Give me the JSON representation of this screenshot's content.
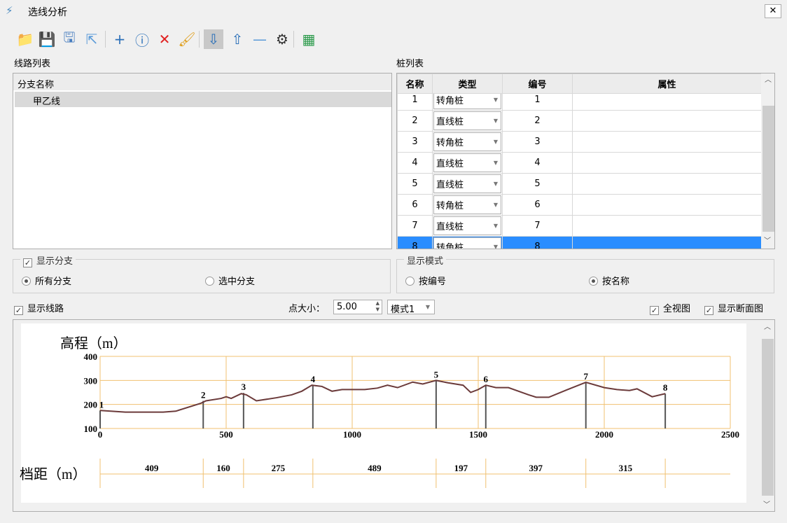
{
  "window": {
    "title": "选线分析",
    "close": "✕"
  },
  "toolbar": [
    {
      "name": "open-folder-icon",
      "glyph": "📁"
    },
    {
      "name": "save-icon",
      "glyph": "💾"
    },
    {
      "name": "save-as-icon",
      "glyph": "🖫"
    },
    {
      "name": "export-icon",
      "glyph": "⇱"
    },
    {
      "name": "add-icon",
      "glyph": "+"
    },
    {
      "name": "info-icon",
      "glyph": "ⓘ"
    },
    {
      "name": "delete-line-icon",
      "glyph": "✕"
    },
    {
      "name": "brush-icon",
      "glyph": "🖌"
    },
    {
      "name": "insert-below-icon",
      "glyph": "⇩"
    },
    {
      "name": "insert-above-icon",
      "glyph": "⇧"
    },
    {
      "name": "remove-icon",
      "glyph": "—"
    },
    {
      "name": "settings-line-icon",
      "glyph": "⚙"
    },
    {
      "name": "map-icon",
      "glyph": "▦"
    }
  ],
  "line_list": {
    "title": "线路列表",
    "header": "分支名称",
    "items": [
      "甲乙线"
    ]
  },
  "pile_list": {
    "title": "桩列表",
    "columns": [
      "名称",
      "类型",
      "编号",
      "属性"
    ],
    "rows": [
      [
        "1",
        "转角桩",
        "1",
        ""
      ],
      [
        "2",
        "直线桩",
        "2",
        ""
      ],
      [
        "3",
        "转角桩",
        "3",
        ""
      ],
      [
        "4",
        "直线桩",
        "4",
        ""
      ],
      [
        "5",
        "直线桩",
        "5",
        ""
      ],
      [
        "6",
        "转角桩",
        "6",
        ""
      ],
      [
        "7",
        "直线桩",
        "7",
        ""
      ],
      [
        "8",
        "转角桩",
        "8",
        ""
      ]
    ],
    "selected": 7
  },
  "branch_group": {
    "title": "显示分支",
    "checked": true,
    "options": [
      "所有分支",
      "选中分支"
    ],
    "selected": 0
  },
  "mode_group": {
    "title": "显示模式",
    "options": [
      "按编号",
      "按名称"
    ],
    "selected": 1
  },
  "controls": {
    "show_line": "显示线路",
    "point_size_label": "点大小：",
    "point_size": "5.00",
    "mode": "模式1",
    "full_view": "全视图",
    "show_section": "显示断面图"
  },
  "chart_data": {
    "type": "line",
    "ylabel": "高程（m）",
    "span_label": "档距（m）",
    "xlim": [
      0,
      2500
    ],
    "ylim": [
      100,
      400
    ],
    "xticks": [
      "0",
      "500",
      "1000",
      "1500",
      "2000",
      "2500"
    ],
    "yticks": [
      "400",
      "300",
      "200",
      "100"
    ],
    "terrain": [
      [
        0,
        175
      ],
      [
        100,
        168
      ],
      [
        250,
        168
      ],
      [
        300,
        172
      ],
      [
        400,
        205
      ],
      [
        420,
        215
      ],
      [
        480,
        225
      ],
      [
        500,
        232
      ],
      [
        520,
        225
      ],
      [
        560,
        245
      ],
      [
        580,
        240
      ],
      [
        620,
        215
      ],
      [
        700,
        228
      ],
      [
        760,
        240
      ],
      [
        800,
        255
      ],
      [
        840,
        280
      ],
      [
        880,
        275
      ],
      [
        920,
        255
      ],
      [
        960,
        262
      ],
      [
        1050,
        262
      ],
      [
        1100,
        268
      ],
      [
        1140,
        280
      ],
      [
        1180,
        270
      ],
      [
        1240,
        293
      ],
      [
        1280,
        285
      ],
      [
        1333,
        300
      ],
      [
        1380,
        290
      ],
      [
        1440,
        280
      ],
      [
        1470,
        250
      ],
      [
        1500,
        262
      ],
      [
        1530,
        280
      ],
      [
        1570,
        270
      ],
      [
        1620,
        270
      ],
      [
        1700,
        240
      ],
      [
        1730,
        230
      ],
      [
        1780,
        230
      ],
      [
        1850,
        260
      ],
      [
        1927,
        292
      ],
      [
        2000,
        270
      ],
      [
        2050,
        262
      ],
      [
        2100,
        258
      ],
      [
        2130,
        265
      ],
      [
        2190,
        232
      ],
      [
        2242,
        245
      ]
    ],
    "poles": [
      {
        "label": "1",
        "x": 0,
        "y": 175
      },
      {
        "label": "2",
        "x": 409,
        "y": 215
      },
      {
        "label": "3",
        "x": 569,
        "y": 248
      },
      {
        "label": "4",
        "x": 844,
        "y": 280
      },
      {
        "label": "5",
        "x": 1333,
        "y": 300
      },
      {
        "label": "6",
        "x": 1530,
        "y": 280
      },
      {
        "label": "7",
        "x": 1927,
        "y": 292
      },
      {
        "label": "8",
        "x": 2242,
        "y": 245
      }
    ],
    "spans": [
      "409",
      "160",
      "275",
      "489",
      "197",
      "397",
      "315"
    ],
    "colors": {
      "grid": "#f0c070",
      "terrain": "#6b3a3a",
      "pole": "#555555"
    }
  }
}
